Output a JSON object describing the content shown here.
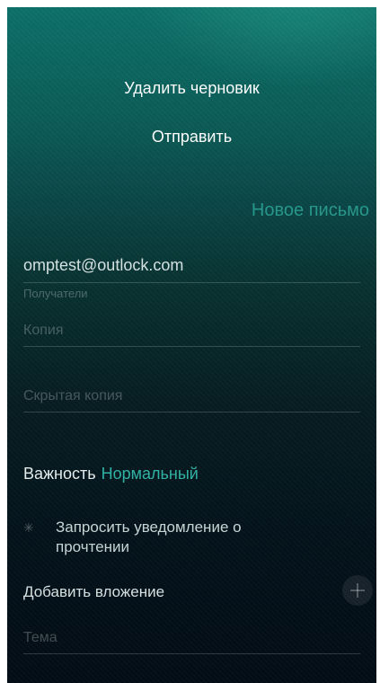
{
  "menu": {
    "delete_draft": "Удалить черновик",
    "send": "Отправить"
  },
  "page": {
    "title": "Новое письмо"
  },
  "form": {
    "from_value": "omptest@outlock.com",
    "recipients_placeholder": "Получатели",
    "cc_placeholder": "Копия",
    "bcc_placeholder": "Скрытая копия",
    "priority_label": "Важность",
    "priority_value": "Нормальный",
    "read_receipt_label": "Запросить уведомление о прочтении",
    "attach_label": "Добавить вложение",
    "subject_placeholder": "Тема"
  },
  "colors": {
    "accent": "#2fb3a4",
    "background_top": "#0c6f69",
    "background_bottom": "#020c14"
  },
  "icons": {
    "read_receipt": "star-icon",
    "attach": "plus-icon"
  }
}
